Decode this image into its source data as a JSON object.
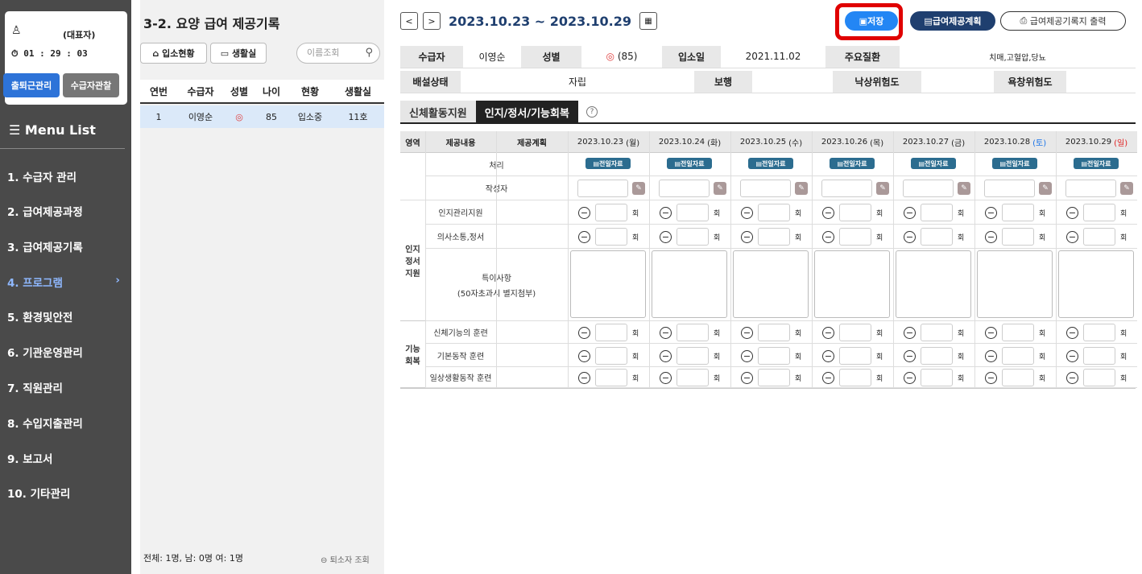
{
  "sidebar": {
    "user_name": "(대표자)",
    "timer": "01 : 29 : 03",
    "attend_btn": "출퇴근관리",
    "observe_btn": "수급자관찰",
    "menu_title": "Menu List",
    "items": [
      {
        "label": "1. 수급자 관리"
      },
      {
        "label": "2. 급여제공과정"
      },
      {
        "label": "3. 급여제공기록"
      },
      {
        "label": "4. 프로그램"
      },
      {
        "label": "5. 환경및안전"
      },
      {
        "label": "6. 기관운영관리"
      },
      {
        "label": "7. 직원관리"
      },
      {
        "label": "8. 수입지출관리"
      },
      {
        "label": "9. 보고서"
      },
      {
        "label": "10. 기타관리"
      }
    ],
    "active_index": 3
  },
  "listpanel": {
    "title": "3-2. 요양 급여 제공기록",
    "btn_admission": "입소현황",
    "btn_room": "생활실",
    "search_placeholder": "이름조회",
    "headers": [
      "연번",
      "수급자",
      "성별",
      "나이",
      "현황",
      "생활실"
    ],
    "rows": [
      {
        "no": "1",
        "name": "이영순",
        "age": "85",
        "status": "입소중",
        "room": "11호"
      }
    ],
    "footer": "전체: 1명, 남: 0명 여: 1명",
    "retired_btn": "퇴소자 조회"
  },
  "toolbar": {
    "date_range": "2023.10.23 ~ 2023.10.29",
    "save": "저장",
    "plan": "급여제공계획",
    "print": "급여제공기록지 출력"
  },
  "info": {
    "recipient_label": "수급자",
    "recipient": "이영순",
    "gender_label": "성별",
    "age_text": "(85)",
    "admit_label": "입소일",
    "admit_date": "2021.11.02",
    "disease_label": "주요질환",
    "disease": "치매,고혈압,당뇨",
    "excretion_label": "배설상태",
    "excretion": "자립",
    "walk_label": "보행",
    "fall_label": "낙상위험도",
    "sore_label": "욕창위험도"
  },
  "tabs": [
    "신체활동지원",
    "인지/정서/기능회복"
  ],
  "grid": {
    "h_area": "영역",
    "h_content": "제공내용",
    "h_plan": "제공계획",
    "days": [
      {
        "date": "2023.10.23",
        "dow": "(월)",
        "color": "#222"
      },
      {
        "date": "2023.10.24",
        "dow": "(화)",
        "color": "#222"
      },
      {
        "date": "2023.10.25",
        "dow": "(수)",
        "color": "#222"
      },
      {
        "date": "2023.10.26",
        "dow": "(목)",
        "color": "#222"
      },
      {
        "date": "2023.10.27",
        "dow": "(금)",
        "color": "#222"
      },
      {
        "date": "2023.10.28",
        "dow": "(토)",
        "color": "#1a73e8"
      },
      {
        "date": "2023.10.29",
        "dow": "(일)",
        "color": "#e02020"
      }
    ],
    "ref_label": "전일자료",
    "r_process": "처리",
    "r_writer": "작성자",
    "area_cog": "인지\n정서\n지원",
    "r_cog1": "인지관리지원",
    "r_cog2": "의사소통,정서",
    "r_note": "특이사항",
    "r_note_sub": "(50자초과시 별지첨부)",
    "area_func": "기능\n회복",
    "r_f1": "신체기능의 훈련",
    "r_f2": "기본동작 훈련",
    "r_f3": "일상생활동작 훈련",
    "unit": "회"
  }
}
